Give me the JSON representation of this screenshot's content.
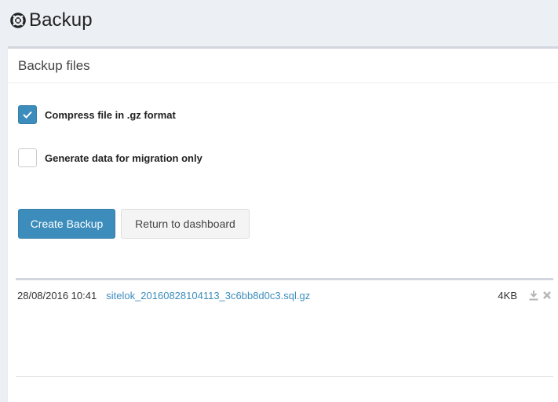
{
  "header": {
    "title": "Backup",
    "icon": "life-ring-icon"
  },
  "panel": {
    "heading": "Backup files"
  },
  "options": [
    {
      "label": "Compress file in .gz format",
      "checked": true
    },
    {
      "label": "Generate data for migration only",
      "checked": false
    }
  ],
  "buttons": {
    "create": "Create Backup",
    "dashboard": "Return to dashboard"
  },
  "files": [
    {
      "date": "28/08/2016 10:41",
      "name": "sitelok_20160828104113_3c6bb8d0c3.sql.gz",
      "size": "4KB",
      "download_icon": "download-icon",
      "delete_icon": "delete-icon"
    }
  ],
  "colors": {
    "primary": "#3c8dbc",
    "background": "#ecf0f5",
    "icon_gray": "#b5b5b5"
  }
}
